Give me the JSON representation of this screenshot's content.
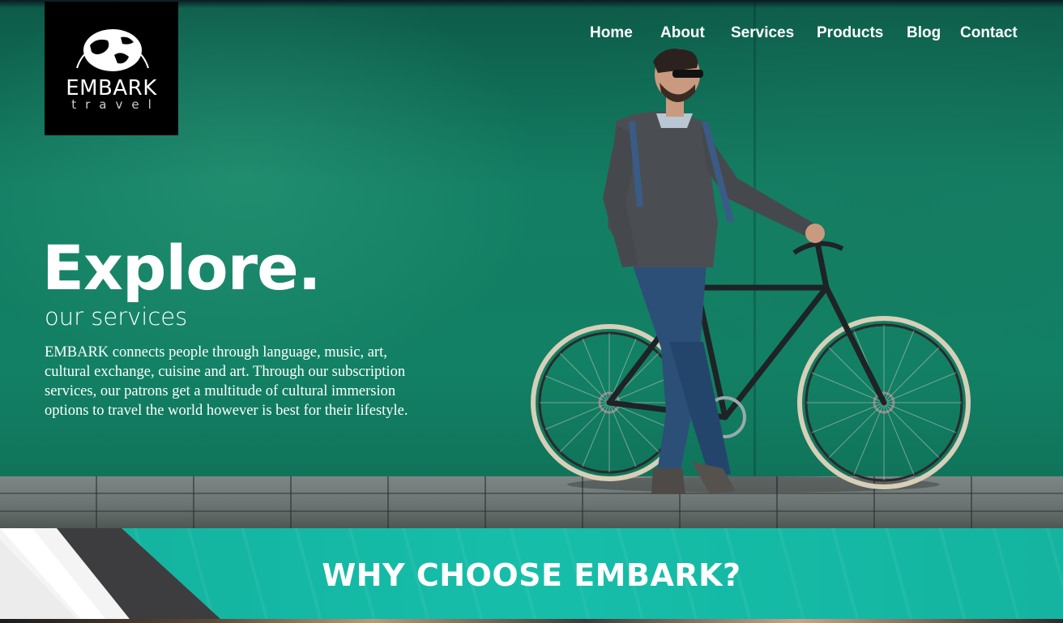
{
  "logo": {
    "title": "EMBARK",
    "subtitle": "travel"
  },
  "nav": {
    "items": [
      {
        "label": "Home"
      },
      {
        "label": "About"
      },
      {
        "label": "Services"
      },
      {
        "label": "Products"
      },
      {
        "label": "Blog"
      },
      {
        "label": "Contact"
      }
    ]
  },
  "hero": {
    "heading": "Explore.",
    "subheading": "our services",
    "description": "EMBARK connects people through language, music, art, cultural exchange, cuisine and art. Through our subscription services, our patrons get a multitude of cultural immersion options to travel the world however is best for their lifestyle."
  },
  "why": {
    "title": "WHY CHOOSE EMBARK?"
  },
  "colors": {
    "hero_green": "#128064",
    "band_teal": "#16bea9",
    "logo_bg": "#000000",
    "text": "#ffffff"
  },
  "icons": {
    "logo": "globe-icon"
  }
}
